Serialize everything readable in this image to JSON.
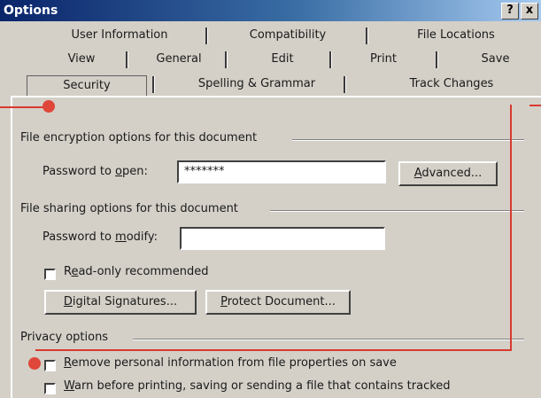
{
  "window": {
    "title": "Options",
    "help_label": "?",
    "close_label": "x"
  },
  "tabs": {
    "row1": [
      "User Information",
      "Compatibility",
      "File Locations"
    ],
    "row2": [
      "View",
      "General",
      "Edit",
      "Print",
      "Save"
    ],
    "row3": [
      "Security",
      "Spelling & Grammar",
      "Track Changes"
    ],
    "active": "Security"
  },
  "encryption": {
    "group_label": "File encryption options for this document",
    "password_label_pre": "Password to ",
    "password_label_u": "o",
    "password_label_post": "pen:",
    "password_value": "*******",
    "advanced_u": "A",
    "advanced_rest": "dvanced..."
  },
  "sharing": {
    "group_label": "File sharing options for this document",
    "modify_label_pre": "Password to ",
    "modify_label_u": "m",
    "modify_label_post": "odify:",
    "modify_value": "",
    "readonly_pre": "R",
    "readonly_u": "e",
    "readonly_post": "ad-only recommended",
    "digital_u": "D",
    "digital_rest": "igital Signatures...",
    "protect_u": "P",
    "protect_rest": "rotect Document..."
  },
  "privacy": {
    "group_label": "Privacy options",
    "remove_u": "R",
    "remove_rest": "emove personal information from file properties on save",
    "warn_u": "W",
    "warn_rest": "arn before printing, saving or sending a file that contains tracked"
  },
  "colors": {
    "title_bar": "#0a246a",
    "dialog_face": "#d4d0c8",
    "callout": "#d83a30"
  }
}
